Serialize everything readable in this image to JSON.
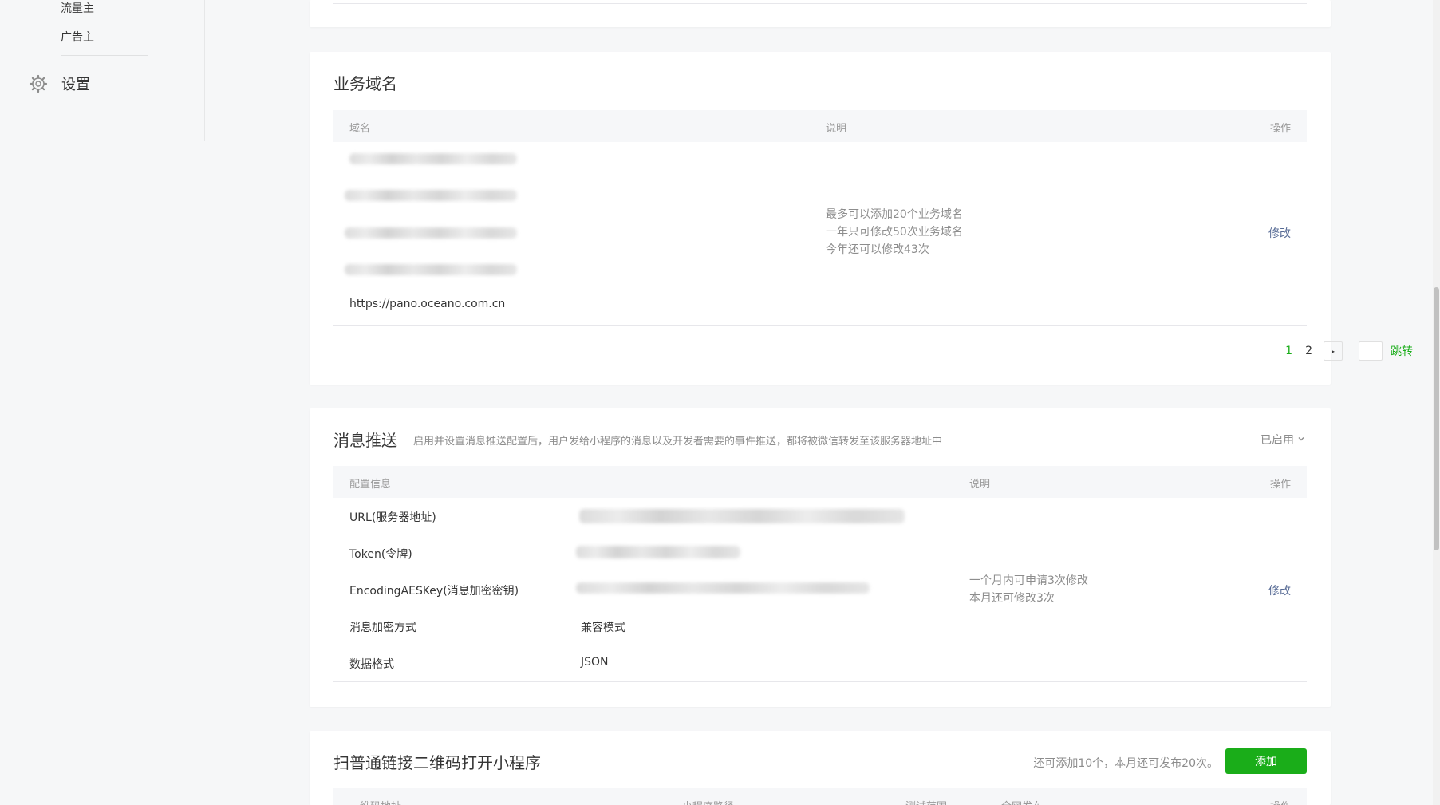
{
  "sidebar": {
    "items": [
      {
        "label": "流量主"
      },
      {
        "label": "广告主"
      }
    ],
    "settings_label": "设置",
    "settings_icon": "gear-icon"
  },
  "business_domain": {
    "title": "业务域名",
    "columns": {
      "domain": "域名",
      "desc": "说明",
      "action": "操作"
    },
    "visible_domain": "https://pano.oceano.com.cn",
    "notes": [
      "最多可以添加20个业务域名",
      "一年只可修改50次业务域名",
      "今年还可以修改43次"
    ],
    "edit_label": "修改",
    "pagination": {
      "pages": [
        "1",
        "2"
      ],
      "current": "1",
      "next_icon": "chevron-right-icon",
      "jump_label": "跳转"
    }
  },
  "message_push": {
    "title": "消息推送",
    "description": "启用并设置消息推送配置后，用户发给小程序的消息以及开发者需要的事件推送，都将被微信转发至该服务器地址中",
    "status": "已启用",
    "status_icon": "chevron-down-icon",
    "columns": {
      "config": "配置信息",
      "desc": "说明",
      "action": "操作"
    },
    "rows": [
      {
        "label": "URL(服务器地址)",
        "value": ""
      },
      {
        "label": "Token(令牌)",
        "value": ""
      },
      {
        "label": "EncodingAESKey(消息加密密钥)",
        "value": ""
      },
      {
        "label": "消息加密方式",
        "value": "兼容模式"
      },
      {
        "label": "数据格式",
        "value": "JSON"
      }
    ],
    "notes": [
      "一个月内可申请3次修改",
      "本月还可修改3次"
    ],
    "edit_label": "修改"
  },
  "qrcode": {
    "title": "扫普通链接二维码打开小程序",
    "hint": "还可添加10个，本月还可发布20次。",
    "add_label": "添加",
    "columns": [
      "二维码地址",
      "小程序路径",
      "测试范围",
      "全网发布",
      "操作"
    ]
  },
  "colors": {
    "accent": "#1aad19",
    "link": "#576b95"
  }
}
